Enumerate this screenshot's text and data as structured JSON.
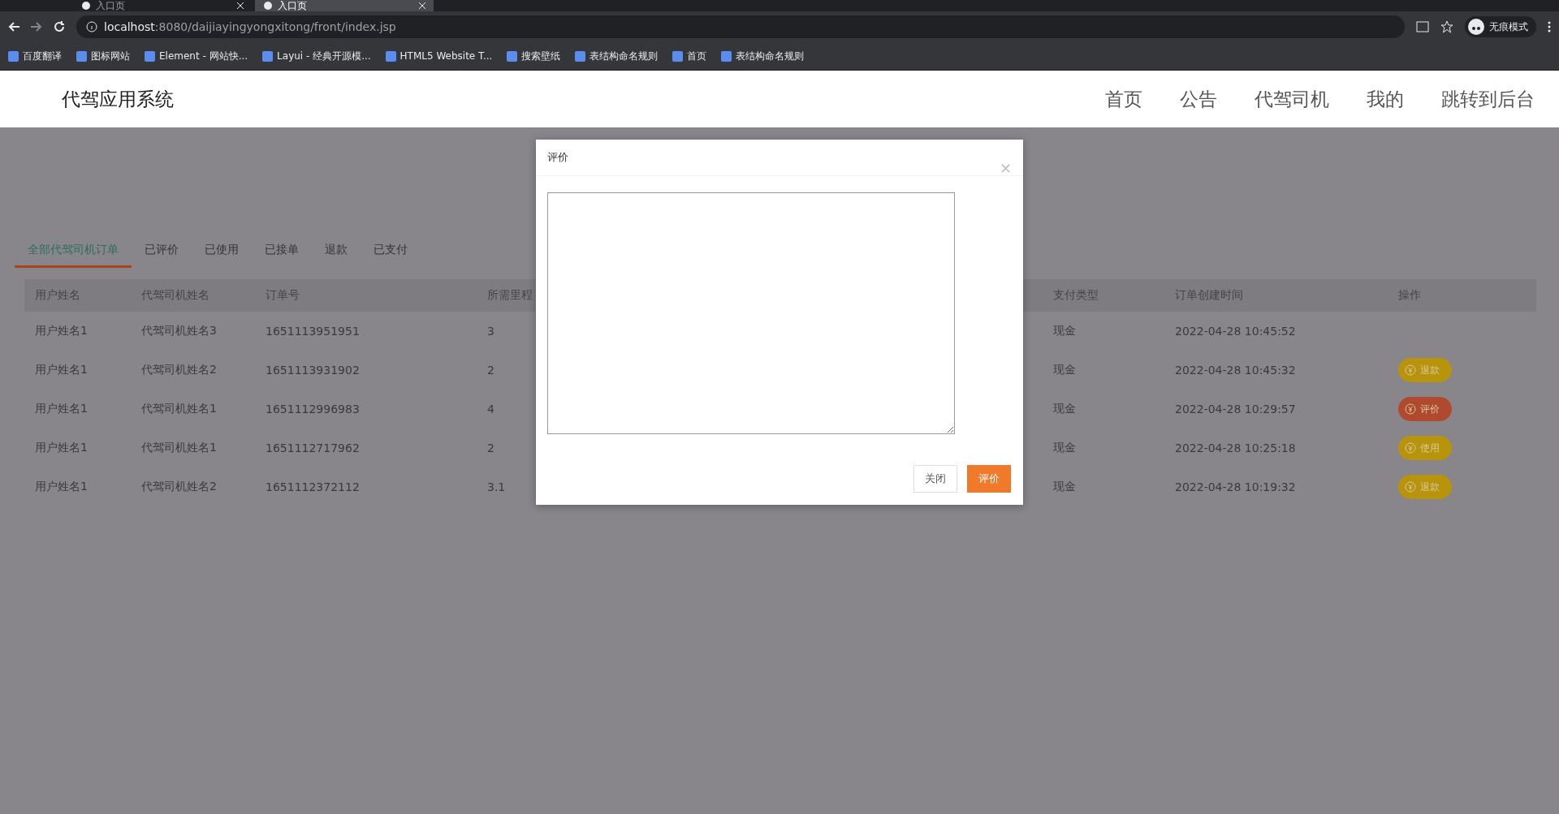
{
  "browser": {
    "tabs": [
      {
        "title": "入口页",
        "selected": false
      },
      {
        "title": "入口页",
        "selected": true
      }
    ],
    "address": {
      "host": "localhost",
      "rest": ":8080/daijiayingyongxitong/front/index.jsp"
    },
    "profile": "无痕模式",
    "bookmarks": [
      "百度翻译",
      "图标网站",
      "Element - 网站快...",
      "Layui - 经典开源模...",
      "HTML5 Website T...",
      "搜索壁纸",
      "表结构命名规则",
      "首页",
      "表结构命名规则"
    ]
  },
  "header": {
    "title": "代驾应用系统",
    "nav": [
      "首页",
      "公告",
      "代驾司机",
      "我的",
      "跳转到后台"
    ]
  },
  "order_tabs": [
    {
      "label": "全部代驾司机订单",
      "selected": true
    },
    {
      "label": "已评价",
      "selected": false
    },
    {
      "label": "已使用",
      "selected": false
    },
    {
      "label": "已接单",
      "selected": false
    },
    {
      "label": "退款",
      "selected": false
    },
    {
      "label": "已支付",
      "selected": false
    }
  ],
  "table": {
    "columns": [
      "用户姓名",
      "代驾司机姓名",
      "订单号",
      "所需里程",
      "支付类型",
      "订单创建时间",
      "操作"
    ],
    "rows": [
      {
        "cells": [
          "用户姓名1",
          "代驾司机姓名3",
          "1651113951951",
          "3",
          "现金",
          "2022-04-28 10:45:52"
        ]
      },
      {
        "cells": [
          "用户姓名1",
          "代驾司机姓名2",
          "1651113931902",
          "2",
          "现金",
          "2022-04-28 10:45:32"
        ],
        "action": {
          "label": "退款",
          "color": "#b8930c"
        }
      },
      {
        "cells": [
          "用户姓名1",
          "代驾司机姓名1",
          "1651112996983",
          "4",
          "现金",
          "2022-04-28 10:29:57"
        ],
        "action": {
          "label": "评价",
          "color": "#b04a2e"
        }
      },
      {
        "cells": [
          "用户姓名1",
          "代驾司机姓名1",
          "1651112717962",
          "2",
          "现金",
          "2022-04-28 10:25:18"
        ],
        "action": {
          "label": "使用",
          "color": "#b8930c"
        }
      },
      {
        "cells": [
          "用户姓名1",
          "代驾司机姓名2",
          "1651112372112",
          "3.1",
          "现金",
          "2022-04-28 10:19:32"
        ],
        "action": {
          "label": "退款",
          "color": "#b8930c"
        }
      }
    ]
  },
  "dialog": {
    "title": "评价",
    "close": "×",
    "buttons": [
      {
        "label": "关闭",
        "kind": "secondary"
      },
      {
        "label": "评价",
        "kind": "primary"
      }
    ]
  }
}
